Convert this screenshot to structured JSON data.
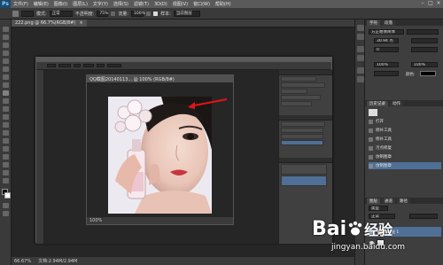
{
  "app": {
    "logo": "Ps"
  },
  "menu": [
    "文件(F)",
    "编辑(E)",
    "图像(I)",
    "图层(L)",
    "文字(Y)",
    "选择(S)",
    "滤镜(T)",
    "3D(D)",
    "视图(V)",
    "窗口(W)",
    "帮助(H)"
  ],
  "window_controls": [
    "–",
    "□",
    "×"
  ],
  "options": {
    "mode_label": "模式:",
    "mode_value": "正常",
    "opacity_label": "不透明度:",
    "opacity_value": "75%",
    "flow_label": "流量:",
    "flow_value": "100%",
    "sample_label": "样本:",
    "sample_value": "当前图层"
  },
  "document": {
    "tab_label": "222.png @ 66.7%(RGB/8#)",
    "close": "×",
    "zoom": "66.67%",
    "doc_size": "文档:2.94M/2.94M"
  },
  "inner_document": {
    "title": "QQ截图20140113... @ 100% (RGB/8#)",
    "zoom": "100%"
  },
  "right_panel": {
    "tabs_top": [
      "字符",
      "段落"
    ],
    "font_name": "方正粗倩简体",
    "font_size": "30.94 点",
    "tracking": "0",
    "scale_v": "100%",
    "scale_h": "100%",
    "color_label": "颜色:",
    "history_tabs": [
      "历史记录",
      "动作"
    ],
    "history_items": [
      "打开",
      "修补工具",
      "修补工具",
      "污点修复",
      "仿制图章",
      "仿制图章"
    ],
    "layer_tabs": [
      "图层",
      "通道",
      "路径"
    ],
    "layer_kind": "类型",
    "blend_mode": "正常",
    "layer_name": "图层 1"
  },
  "watermark": {
    "brand": "Bai",
    "brand_cn": "经验",
    "domain": "jingyan.baidu.com"
  },
  "colors": {
    "accent": "#4f6f96",
    "arrow": "#e0141a"
  },
  "icons": [
    "photoshop-logo",
    "brush-tool-icon",
    "eye-icon",
    "paw-icon",
    "arrow-annotation"
  ]
}
